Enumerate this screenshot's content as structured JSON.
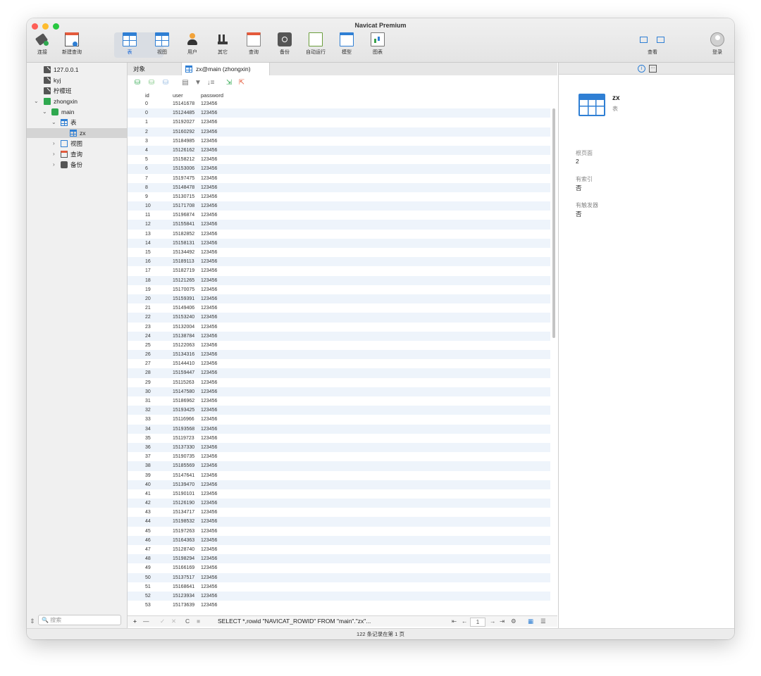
{
  "window": {
    "title": "Navicat Premium"
  },
  "toolbar": {
    "connect": "连接",
    "new_query": "新建查询",
    "table": "表",
    "view": "视图",
    "user": "用户",
    "other": "其它",
    "query": "查询",
    "backup": "备份",
    "automation": "自动运行",
    "model": "模型",
    "chart": "图表",
    "view_menu": "查看",
    "login": "登录"
  },
  "sidebar": {
    "connections": [
      "127.0.0.1",
      "kyj",
      "柠檬班"
    ],
    "zhongxin": "zhongxin",
    "main": "main",
    "tables_folder": "表",
    "table_zx": "zx",
    "views_folder": "视图",
    "queries_folder": "查询",
    "backups_folder": "备份",
    "search_placeholder": "搜索"
  },
  "tabs": {
    "objects": "对象",
    "active": "zx@main (zhongxin)"
  },
  "grid": {
    "columns": [
      "id",
      "user",
      "password"
    ],
    "rows": [
      [
        "0",
        "15141678",
        "123456"
      ],
      [
        "0",
        "15124485",
        "123456"
      ],
      [
        "1",
        "15192027",
        "123456"
      ],
      [
        "2",
        "15160292",
        "123456"
      ],
      [
        "3",
        "15184985",
        "123456"
      ],
      [
        "4",
        "15126162",
        "123456"
      ],
      [
        "5",
        "15158212",
        "123456"
      ],
      [
        "6",
        "15153006",
        "123456"
      ],
      [
        "7",
        "15197475",
        "123456"
      ],
      [
        "8",
        "15148478",
        "123456"
      ],
      [
        "9",
        "15130715",
        "123456"
      ],
      [
        "10",
        "15171708",
        "123456"
      ],
      [
        "11",
        "15196874",
        "123456"
      ],
      [
        "12",
        "15155841",
        "123456"
      ],
      [
        "13",
        "15182852",
        "123456"
      ],
      [
        "14",
        "15158131",
        "123456"
      ],
      [
        "15",
        "15134492",
        "123456"
      ],
      [
        "16",
        "15189113",
        "123456"
      ],
      [
        "17",
        "15182719",
        "123456"
      ],
      [
        "18",
        "15121265",
        "123456"
      ],
      [
        "19",
        "15170075",
        "123456"
      ],
      [
        "20",
        "15159391",
        "123456"
      ],
      [
        "21",
        "15149406",
        "123456"
      ],
      [
        "22",
        "15153240",
        "123456"
      ],
      [
        "23",
        "15132004",
        "123456"
      ],
      [
        "24",
        "15138784",
        "123456"
      ],
      [
        "25",
        "15122063",
        "123456"
      ],
      [
        "26",
        "15134316",
        "123456"
      ],
      [
        "27",
        "15144410",
        "123456"
      ],
      [
        "28",
        "15159447",
        "123456"
      ],
      [
        "29",
        "15115263",
        "123456"
      ],
      [
        "30",
        "15147580",
        "123456"
      ],
      [
        "31",
        "15186962",
        "123456"
      ],
      [
        "32",
        "15193425",
        "123456"
      ],
      [
        "33",
        "15116966",
        "123456"
      ],
      [
        "34",
        "15193568",
        "123456"
      ],
      [
        "35",
        "15119723",
        "123456"
      ],
      [
        "36",
        "15137330",
        "123456"
      ],
      [
        "37",
        "15190735",
        "123456"
      ],
      [
        "38",
        "15185569",
        "123456"
      ],
      [
        "39",
        "15147641",
        "123456"
      ],
      [
        "40",
        "15139470",
        "123456"
      ],
      [
        "41",
        "15190101",
        "123456"
      ],
      [
        "42",
        "15126190",
        "123456"
      ],
      [
        "43",
        "15134717",
        "123456"
      ],
      [
        "44",
        "15198532",
        "123456"
      ],
      [
        "45",
        "15197263",
        "123456"
      ],
      [
        "46",
        "15164363",
        "123456"
      ],
      [
        "47",
        "15128740",
        "123456"
      ],
      [
        "48",
        "15198294",
        "123456"
      ],
      [
        "49",
        "15166169",
        "123456"
      ],
      [
        "50",
        "15137517",
        "123456"
      ],
      [
        "51",
        "15168641",
        "123456"
      ],
      [
        "52",
        "15123934",
        "123456"
      ],
      [
        "53",
        "15173639",
        "123456"
      ]
    ]
  },
  "bottom_bar": {
    "add": "+",
    "remove": "—",
    "apply": "✓",
    "discard": "✕",
    "refresh": "C",
    "stop": "■",
    "sql": "SELECT *,rowid \"NAVICAT_ROWID\" FROM \"main\".\"zx\"...",
    "first": "⇤",
    "prev": "←",
    "page": "1",
    "next": "→",
    "last": "⇥",
    "settings": "⚙"
  },
  "status": "122 条记录在第 1 页",
  "info": {
    "name": "zx",
    "type": "表",
    "rows_label": "根页面",
    "rows_value": "2",
    "index_label": "有索引",
    "index_value": "否",
    "trigger_label": "有触发器",
    "trigger_value": "否"
  }
}
